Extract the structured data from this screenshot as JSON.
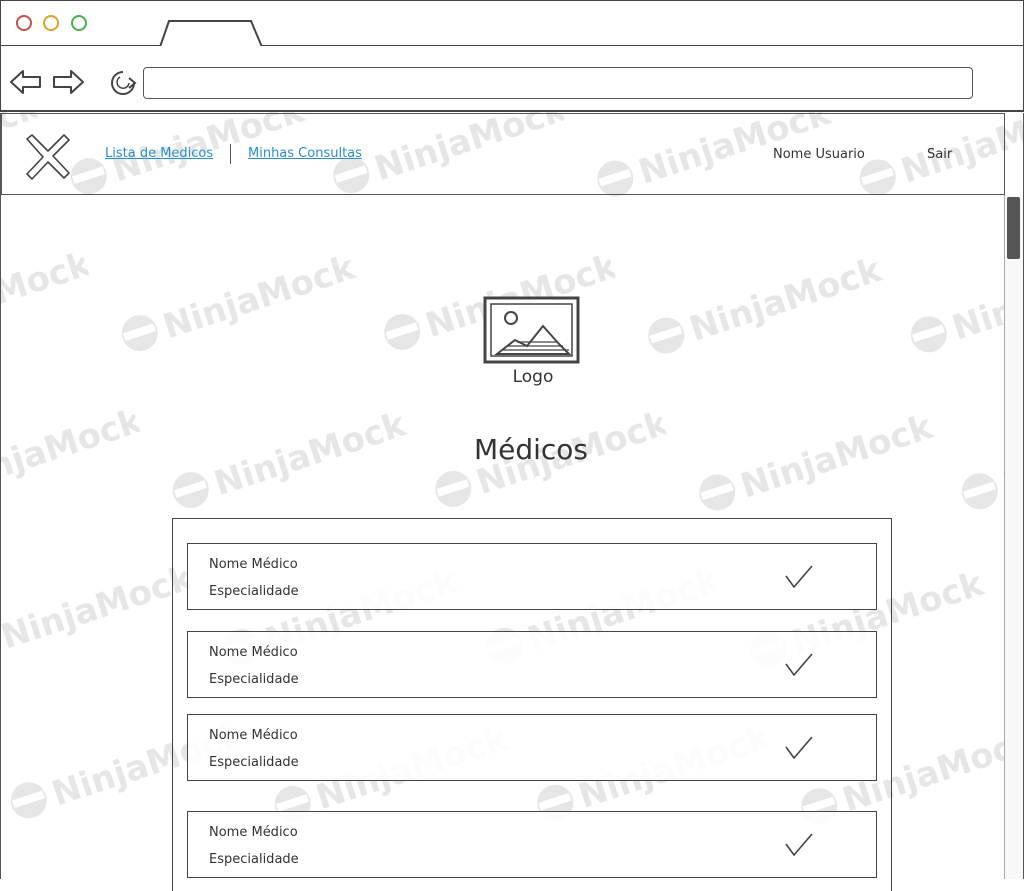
{
  "watermark": "NinjaMock",
  "browser": {
    "window_controls": [
      "close",
      "minimize",
      "maximize"
    ],
    "nav_icons": [
      "back-arrow-icon",
      "forward-arrow-icon",
      "reload-icon"
    ],
    "url": ""
  },
  "app_nav": {
    "logo_icon": "close-x-icon",
    "links": [
      "Lista de Medicos",
      "Minhas Consultas"
    ],
    "user_name": "Nome Usuario",
    "exit_label": "Sair"
  },
  "logo": {
    "icon": "image-placeholder-icon",
    "label": "Logo"
  },
  "page_title": "Médicos",
  "doctors": [
    {
      "name": "Nome Médico",
      "specialty": "Especialidade",
      "icon": "check-icon"
    },
    {
      "name": "Nome Médico",
      "specialty": "Especialidade",
      "icon": "check-icon"
    },
    {
      "name": "Nome Médico",
      "specialty": "Especialidade",
      "icon": "check-icon"
    },
    {
      "name": "Nome Médico",
      "specialty": "Especialidade",
      "icon": "check-icon"
    }
  ],
  "colors": {
    "link": "#2a8fc9",
    "close_dot": "#c0504d",
    "minimize_dot": "#e0a030",
    "maximize_dot": "#4caf50",
    "stroke": "#444444"
  }
}
